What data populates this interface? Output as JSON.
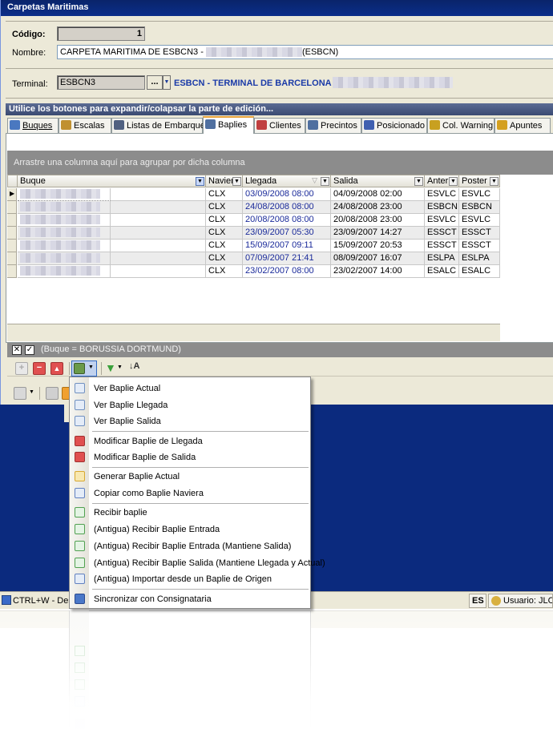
{
  "window": {
    "title": "Carpetas Maritimas"
  },
  "form": {
    "codigo_label": "Código:",
    "codigo_value": "1",
    "nombre_label": "Nombre:",
    "nombre_prefix": "CARPETA MARITIMA DE ESBCN3 - ",
    "nombre_suffix": "(ESBCN)",
    "terminal_label": "Terminal:",
    "terminal_code": "ESBCN3",
    "terminal_button": "...",
    "terminal_name": "ESBCN - TERMINAL DE BARCELONA"
  },
  "infobar": {
    "text": "Utilice los botones para expandir/colapsar la parte de edición..."
  },
  "tabs": [
    {
      "label": "Buques",
      "color": "#4a78c0"
    },
    {
      "label": "Escalas",
      "color": "#c09030"
    },
    {
      "label": "Listas de Embarque",
      "color": "#506080"
    },
    {
      "label": "Baplies",
      "color": "#5070a0"
    },
    {
      "label": "Clientes",
      "color": "#c04040"
    },
    {
      "label": "Precintos",
      "color": "#5070a0"
    },
    {
      "label": "Posicionado",
      "color": "#4060b0"
    },
    {
      "label": "Col. Warning",
      "color": "#c8a020"
    },
    {
      "label": "Apuntes",
      "color": "#d4a020"
    }
  ],
  "grid": {
    "group_hint": "Arrastre una columna aquí para agrupar por dicha columna",
    "columns": [
      "Buque",
      "Naviera",
      "Llegada",
      "Salida",
      "Anter",
      "Poster"
    ],
    "rows": [
      {
        "naviera": "CLX",
        "llegada": "03/09/2008 08:00",
        "salida": "04/09/2008 02:00",
        "anter": "ESVLC",
        "poster": "ESVLC"
      },
      {
        "naviera": "CLX",
        "llegada": "24/08/2008 08:00",
        "salida": "24/08/2008 23:00",
        "anter": "ESBCN",
        "poster": "ESBCN"
      },
      {
        "naviera": "CLX",
        "llegada": "20/08/2008 08:00",
        "salida": "20/08/2008 23:00",
        "anter": "ESVLC",
        "poster": "ESVLC"
      },
      {
        "naviera": "CLX",
        "llegada": "23/09/2007 05:30",
        "salida": "23/09/2007 14:27",
        "anter": "ESSCT",
        "poster": "ESSCT"
      },
      {
        "naviera": "CLX",
        "llegada": "15/09/2007 09:11",
        "salida": "15/09/2007 20:53",
        "anter": "ESSCT",
        "poster": "ESSCT"
      },
      {
        "naviera": "CLX",
        "llegada": "07/09/2007 21:41",
        "salida": "08/09/2007 16:07",
        "anter": "ESLPA",
        "poster": "ESLPA"
      },
      {
        "naviera": "CLX",
        "llegada": "23/02/2007 08:00",
        "salida": "23/02/2007 14:00",
        "anter": "ESALC",
        "poster": "ESALC"
      }
    ],
    "filter_text": "(Buque = BORUSSIA DORTMUND)"
  },
  "menu": {
    "items": [
      {
        "label": "Ver Baplie Actual",
        "icon": "doc-icon",
        "color": "#7090c0"
      },
      {
        "label": "Ver Baplie Llegada",
        "icon": "doc-icon",
        "color": "#7090c0"
      },
      {
        "label": "Ver Baplie Salida",
        "icon": "doc-icon",
        "color": "#7090c0"
      },
      {
        "label": "Modificar Baplie de Llegada",
        "icon": "edit-icon",
        "color": "#e05050"
      },
      {
        "label": "Modificar Baplie de Salida",
        "icon": "edit-icon",
        "color": "#e05050"
      },
      {
        "label": "Generar Baplie Actual",
        "icon": "generate-icon",
        "color": "#d8a830"
      },
      {
        "label": "Copiar como Baplie Naviera",
        "icon": "copy-icon",
        "color": "#6080c0"
      },
      {
        "label": "Recibir baplie",
        "icon": "receive-icon",
        "color": "#50a050"
      },
      {
        "label": "(Antigua) Recibir Baplie Entrada",
        "icon": "receive-icon",
        "color": "#50a050"
      },
      {
        "label": "(Antigua) Recibir Baplie Entrada (Mantiene Salida)",
        "icon": "receive-icon",
        "color": "#50a050"
      },
      {
        "label": "(Antigua) Recibir Baplie Salida (Mantiene Llegada y Actual)",
        "icon": "receive-icon",
        "color": "#50a050"
      },
      {
        "label": "(Antigua) Importar desde un Baplie de Origen",
        "icon": "import-icon",
        "color": "#6080c0"
      },
      {
        "label": "Sincronizar con Consignataria",
        "icon": "sync-icon",
        "color": "#4a78c8"
      }
    ]
  },
  "statusbar": {
    "shortcut": "CTRL+W  -  Des",
    "lang": "ES",
    "user": "Usuario: JLCAL"
  }
}
